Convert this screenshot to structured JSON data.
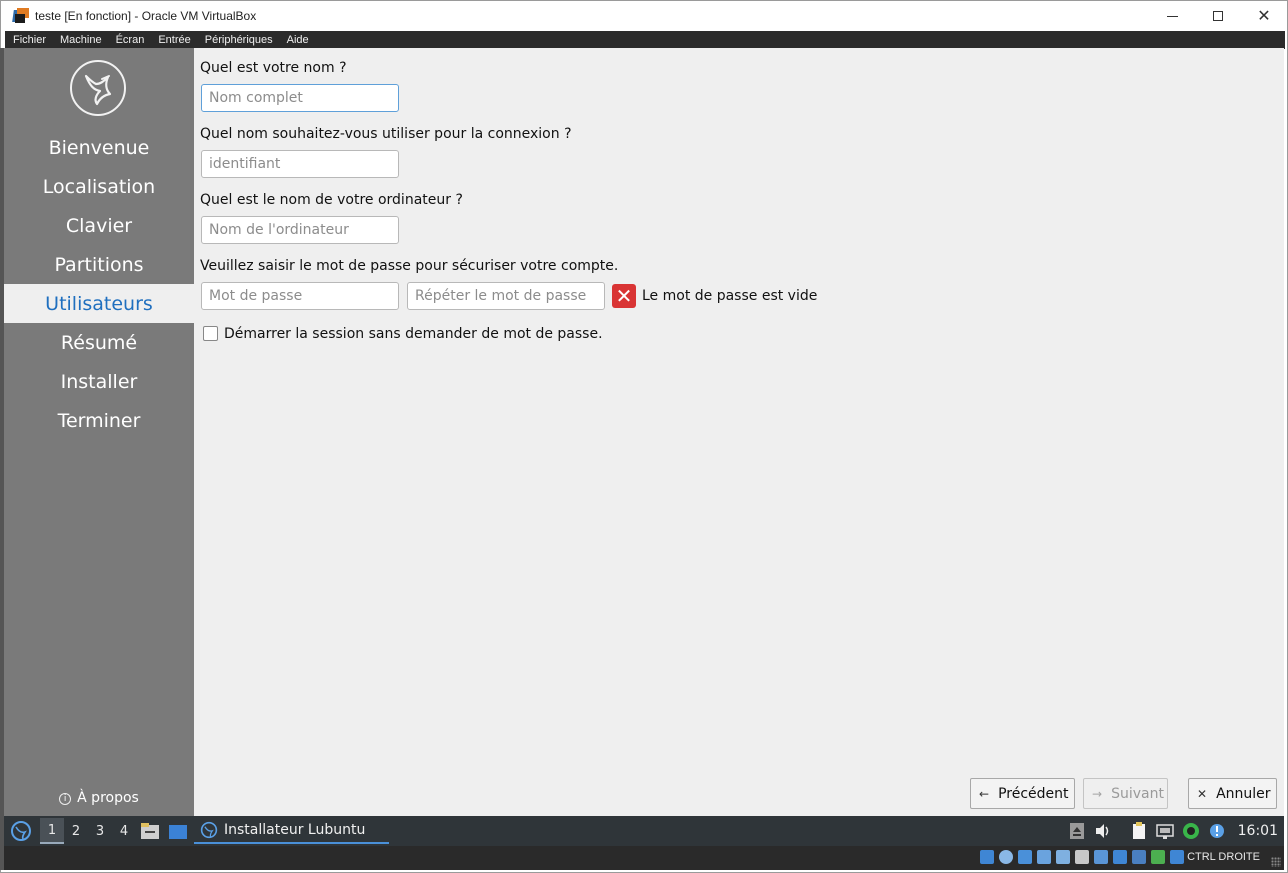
{
  "window": {
    "title": "teste  [En fonction] - Oracle VM VirtualBox"
  },
  "menubar": {
    "items": [
      "Fichier",
      "Machine",
      "Écran",
      "Entrée",
      "Périphériques",
      "Aide"
    ]
  },
  "sidebar": {
    "steps": [
      {
        "label": "Bienvenue",
        "active": false
      },
      {
        "label": "Localisation",
        "active": false
      },
      {
        "label": "Clavier",
        "active": false
      },
      {
        "label": "Partitions",
        "active": false
      },
      {
        "label": "Utilisateurs",
        "active": true
      },
      {
        "label": "Résumé",
        "active": false
      },
      {
        "label": "Installer",
        "active": false
      },
      {
        "label": "Terminer",
        "active": false
      }
    ],
    "about_label": "À propos"
  },
  "form": {
    "name_question": "Quel est votre nom ?",
    "name_placeholder": "Nom complet",
    "login_question": "Quel nom souhaitez-vous utiliser pour la connexion ?",
    "login_placeholder": "identifiant",
    "host_question": "Quel est le nom de votre ordinateur ?",
    "host_placeholder": "Nom de l'ordinateur",
    "password_question": "Veuillez saisir le mot de passe pour sécuriser votre compte.",
    "password_placeholder": "Mot de passe",
    "password_repeat_placeholder": "Répéter le mot de passe",
    "password_error": "Le mot de passe est vide",
    "autologin_label": "Démarrer la session sans demander de mot de passe.",
    "autologin_checked": false
  },
  "buttons": {
    "back": "Précédent",
    "next": "Suivant",
    "cancel": "Annuler"
  },
  "panel": {
    "workspaces": [
      "1",
      "2",
      "3",
      "4"
    ],
    "active_workspace": "1",
    "task_label": "Installateur Lubuntu",
    "clock": "16:01"
  },
  "vbox_status": {
    "host_key": "CTRL DROITE"
  },
  "colors": {
    "accent": "#1f6fbf",
    "sidebar_bg": "#7a7a7a",
    "panel_bg": "#2f3539",
    "error": "#d93434"
  }
}
